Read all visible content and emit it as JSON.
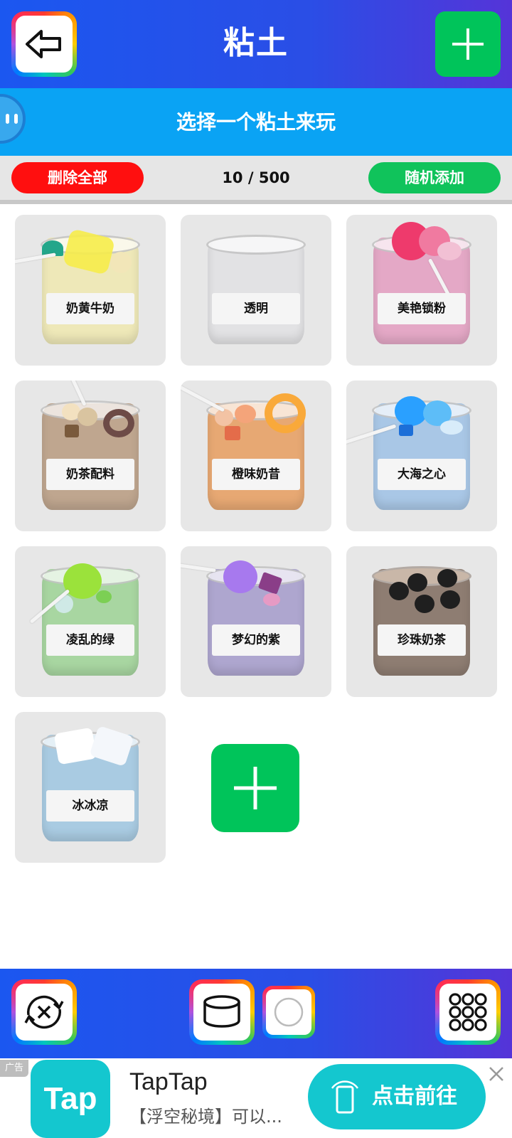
{
  "header": {
    "title": "粘土"
  },
  "subtitle": "选择一个粘土来玩",
  "actions": {
    "delete_all": "删除全部",
    "counter": "10 / 500",
    "random_add": "随机添加"
  },
  "slimes": [
    {
      "name": "奶黄牛奶",
      "color": "#eee8b8",
      "topping": "#f6ec4a"
    },
    {
      "name": "透明",
      "color": "#e2e2e4",
      "topping": "#ffffff"
    },
    {
      "name": "美艳锁粉",
      "color": "#e4a8c6",
      "topping": "#ee3a6c"
    },
    {
      "name": "奶茶配料",
      "color": "#bfa68f",
      "topping": "#f3e1c0"
    },
    {
      "name": "橙味奶昔",
      "color": "#e7a873",
      "topping": "#f9a93a"
    },
    {
      "name": "大海之心",
      "color": "#a9c7e6",
      "topping": "#2aa0ff"
    },
    {
      "name": "凌乱的绿",
      "color": "#a8d6a1",
      "topping": "#9be23b"
    },
    {
      "name": "梦幻的紫",
      "color": "#aea6cf",
      "topping": "#a779ee"
    },
    {
      "name": "珍珠奶茶",
      "color": "#8e7d72",
      "topping": "#1f1f1f"
    },
    {
      "name": "冰冰凉",
      "color": "#a9cbe2",
      "topping": "#ffffff"
    }
  ],
  "bottom_toolbar": [
    "reset-icon",
    "jar-icon",
    "circle-icon",
    "grid-icon"
  ],
  "ad": {
    "badge": "广告",
    "icon_text": "Tap",
    "title": "TapTap",
    "description": "【浮空秘境】可以...",
    "cta": "点击前往"
  }
}
